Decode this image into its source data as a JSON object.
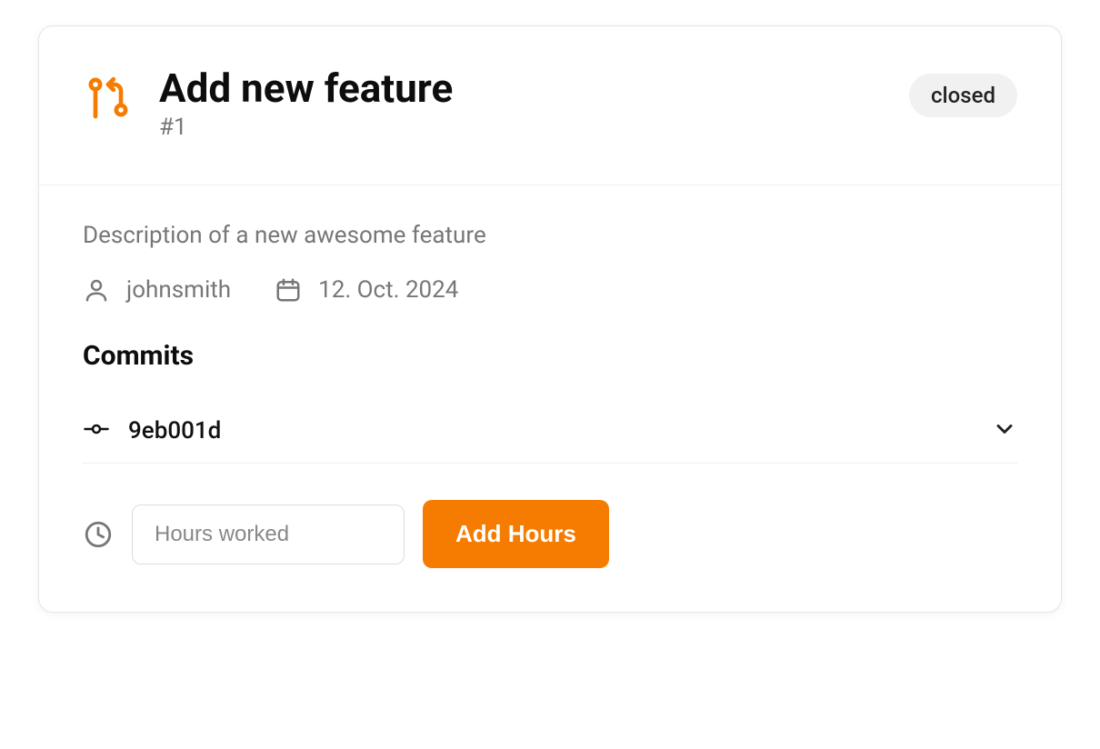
{
  "colors": {
    "accent": "#f57c00"
  },
  "header": {
    "title": "Add new feature",
    "issue_number": "#1",
    "status": "closed"
  },
  "body": {
    "description": "Description of a new awesome feature",
    "author": "johnsmith",
    "date": "12. Oct. 2024"
  },
  "commits": {
    "heading": "Commits",
    "items": [
      {
        "hash": "9eb001d"
      }
    ]
  },
  "hours": {
    "placeholder": "Hours worked",
    "add_button": "Add Hours"
  }
}
